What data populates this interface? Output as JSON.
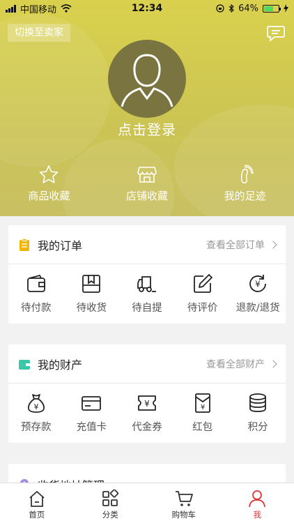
{
  "status_bar": {
    "carrier": "中国移动",
    "time": "12:34",
    "battery": "64%",
    "battery_level": 0.64
  },
  "header": {
    "switch_label": "切换至卖家",
    "login_label": "点击登录",
    "quick_links": [
      {
        "label": "商品收藏",
        "icon": "star-icon"
      },
      {
        "label": "店铺收藏",
        "icon": "store-icon"
      },
      {
        "label": "我的足迹",
        "icon": "footprint-icon"
      }
    ]
  },
  "orders": {
    "title": "我的订单",
    "more": "查看全部订单",
    "items": [
      {
        "label": "待付款",
        "icon": "wallet-icon"
      },
      {
        "label": "待收货",
        "icon": "package-icon"
      },
      {
        "label": "待自提",
        "icon": "truck-icon"
      },
      {
        "label": "待评价",
        "icon": "edit-icon"
      },
      {
        "label": "退款/退货",
        "icon": "refund-icon"
      }
    ]
  },
  "assets": {
    "title": "我的财产",
    "more": "查看全部财产",
    "items": [
      {
        "label": "预存款",
        "icon": "money-bag-icon"
      },
      {
        "label": "充值卡",
        "icon": "card-icon"
      },
      {
        "label": "代金券",
        "icon": "voucher-icon"
      },
      {
        "label": "红包",
        "icon": "red-envelope-icon"
      },
      {
        "label": "积分",
        "icon": "coins-icon"
      }
    ]
  },
  "address": {
    "title": "收货地址管理"
  },
  "tabs": [
    {
      "label": "首页",
      "icon": "home-icon"
    },
    {
      "label": "分类",
      "icon": "category-icon"
    },
    {
      "label": "购物车",
      "icon": "cart-icon"
    },
    {
      "label": "我",
      "icon": "user-icon",
      "active": true
    }
  ],
  "colors": {
    "header": "#d4cc4e",
    "accent": "#e0333a",
    "order_icon": "#f2b705",
    "asset_icon": "#3cc7a7"
  }
}
